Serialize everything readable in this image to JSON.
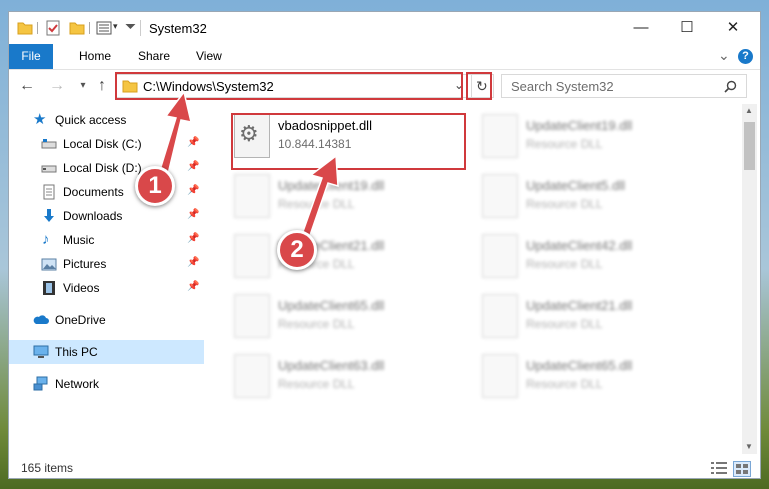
{
  "window": {
    "title": "System32",
    "minimize_glyph": "—",
    "maximize_glyph": "☐",
    "close_glyph": "✕"
  },
  "ribbon": {
    "tabs": [
      "File",
      "Home",
      "Share",
      "View"
    ],
    "expand_glyph": "⌄",
    "help_glyph": "?"
  },
  "navigation": {
    "back_glyph": "←",
    "forward_glyph": "→",
    "recent_glyph": "▾",
    "up_glyph": "↑",
    "address": "C:\\Windows\\System32",
    "search_placeholder": "Search System32"
  },
  "sidebar": {
    "items": [
      {
        "label": "Quick access",
        "icon": "star-icon",
        "pinned": false
      },
      {
        "label": "Local Disk (C:)",
        "icon": "drive-icon",
        "pinned": true
      },
      {
        "label": "Local Disk (D:)",
        "icon": "drive-icon",
        "pinned": true
      },
      {
        "label": "Documents",
        "icon": "documents-icon",
        "pinned": true
      },
      {
        "label": "Downloads",
        "icon": "download-icon",
        "pinned": true
      },
      {
        "label": "Music",
        "icon": "music-icon",
        "pinned": true
      },
      {
        "label": "Pictures",
        "icon": "pictures-icon",
        "pinned": true
      },
      {
        "label": "Videos",
        "icon": "video-icon",
        "pinned": true
      },
      {
        "label": "OneDrive",
        "icon": "cloud-icon",
        "pinned": false
      },
      {
        "label": "This PC",
        "icon": "computer-icon",
        "pinned": false,
        "selected": true
      },
      {
        "label": "Network",
        "icon": "network-icon",
        "pinned": false
      }
    ],
    "pin_glyph": "📌"
  },
  "files": [
    {
      "name": "vbadosnippet.dll",
      "desc": "10.844.14381",
      "highlighted": true
    },
    {
      "name": "UpdateClient19.dll",
      "desc": "Resource DLL"
    },
    {
      "name": "UpdateClient19.dll",
      "desc": "Resource DLL"
    },
    {
      "name": "UpdateClient5.dll",
      "desc": "Resource DLL"
    },
    {
      "name": "UpdateClient21.dll",
      "desc": "Resource DLL"
    },
    {
      "name": "UpdateClient42.dll",
      "desc": "Resource DLL"
    },
    {
      "name": "UpdateClient65.dll",
      "desc": "Resource DLL"
    },
    {
      "name": "UpdateClient21.dll",
      "desc": "Resource DLL"
    },
    {
      "name": "UpdateClient63.dll",
      "desc": "Resource DLL"
    },
    {
      "name": "UpdateClient65.dll",
      "desc": "Resource DLL"
    }
  ],
  "status": {
    "item_count": "165 items"
  },
  "annotations": {
    "step1": "1",
    "step2": "2"
  },
  "colors": {
    "accent": "#1979ca",
    "highlight_box": "#d0393c",
    "selected_nav": "#cde8ff"
  }
}
